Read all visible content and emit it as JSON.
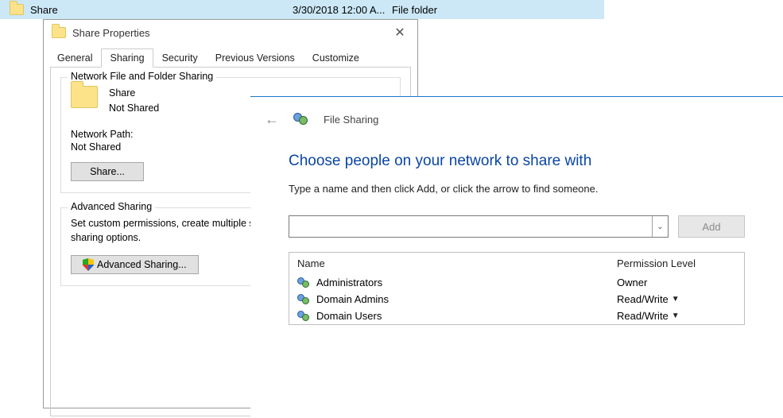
{
  "explorer": {
    "name": "Share",
    "date": "3/30/2018 12:00 A...",
    "type": "File folder"
  },
  "properties": {
    "title": "Share Properties",
    "tabs": [
      "General",
      "Sharing",
      "Security",
      "Previous Versions",
      "Customize"
    ],
    "activeTabIndex": 1,
    "networkGroup": {
      "legend": "Network File and Folder Sharing",
      "itemName": "Share",
      "itemStatus": "Not Shared",
      "pathLabel": "Network Path:",
      "pathValue": "Not Shared",
      "shareButton": "Share..."
    },
    "advancedGroup": {
      "legend": "Advanced Sharing",
      "desc": "Set custom permissions, create multiple shares, and set other advanced sharing options.",
      "button": "Advanced Sharing..."
    }
  },
  "fileSharing": {
    "title": "File Sharing",
    "heading": "Choose people on your network to share with",
    "subtext": "Type a name and then click Add, or click the arrow to find someone.",
    "addButton": "Add",
    "columns": {
      "name": "Name",
      "perm": "Permission Level"
    },
    "entries": [
      {
        "name": "Administrators",
        "perm": "Owner",
        "editable": false
      },
      {
        "name": "Domain Admins",
        "perm": "Read/Write",
        "editable": true
      },
      {
        "name": "Domain Users",
        "perm": "Read/Write",
        "editable": true
      }
    ]
  }
}
